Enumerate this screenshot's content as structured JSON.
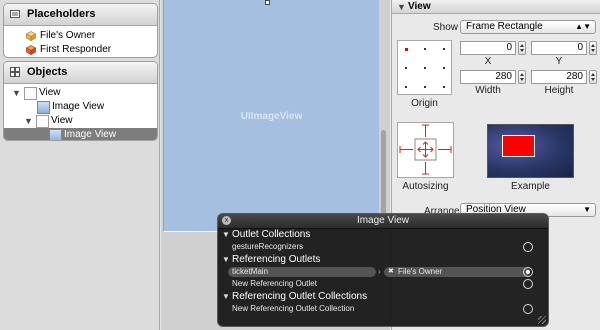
{
  "navigator": {
    "placeholders_header": "Placeholders",
    "placeholders": [
      {
        "label": "File's Owner",
        "icon": "cube-icon"
      },
      {
        "label": "First Responder",
        "icon": "responder-cube-icon"
      }
    ],
    "objects_header": "Objects",
    "objects": [
      {
        "label": "View",
        "expanded": true,
        "icon": "view-icon"
      },
      {
        "label": "Image View",
        "icon": "image-view-icon"
      },
      {
        "label": "View",
        "expanded": true,
        "icon": "view-icon"
      },
      {
        "label": "Image View",
        "icon": "image-view-icon",
        "selected": true
      }
    ]
  },
  "canvas": {
    "image_view_label": "UIImageView",
    "fill_color": "#a5bfe0"
  },
  "inspector": {
    "section_title": "View",
    "show_label": "Show",
    "show_value": "Frame Rectangle",
    "x_value": "0",
    "y_value": "0",
    "x_label": "X",
    "y_label": "Y",
    "width_value": "280",
    "height_value": "280",
    "width_label": "Width",
    "height_label": "Height",
    "origin_label": "Origin",
    "autosizing_label": "Autosizing",
    "example_label": "Example",
    "arrange_label": "Arrange",
    "arrange_value": "Position View"
  },
  "hud": {
    "title": "Image View",
    "close_glyph": "x",
    "sections": {
      "outlet_collections": "Outlet Collections",
      "gesture_recognizers": "gestureRecognizers",
      "referencing_outlets": "Referencing Outlets",
      "ticket_outlet": "ticketMain",
      "ticket_target": "File's Owner",
      "ticket_remove": "✖",
      "new_referencing_outlet": "New Referencing Outlet",
      "referencing_outlet_collections": "Referencing Outlet Collections",
      "new_referencing_outlet_collection": "New Referencing Outlet Collection"
    }
  }
}
